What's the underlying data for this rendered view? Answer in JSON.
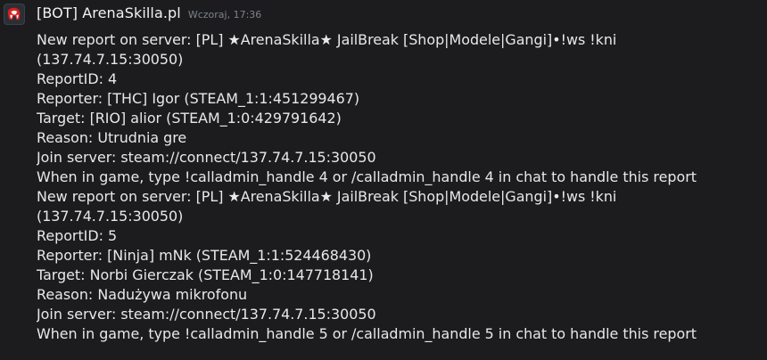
{
  "header": {
    "username": "[BOT] ArenaSkilla.pl",
    "timestamp": "Wczoraj, 17:36"
  },
  "avatar_icon": "arena-helmet-icon",
  "reports": [
    {
      "line1": "New report on server: [PL] ★ArenaSkilla★ JailBreak [Shop|Modele|Gangi]•!ws !kni",
      "line2": "(137.74.7.15:30050)",
      "report_id": "ReportID: 4",
      "reporter": "Reporter: [THC] Igor (STEAM_1:1:451299467)",
      "target": "Target: [RIO] alior (STEAM_1:0:429791642)",
      "reason": "Reason: Utrudnia gre",
      "join": "Join server: steam://connect/137.74.7.15:30050",
      "handle": "When in game, type !calladmin_handle 4 or /calladmin_handle 4 in chat to handle this report"
    },
    {
      "line1": "New report on server: [PL] ★ArenaSkilla★ JailBreak [Shop|Modele|Gangi]•!ws !kni",
      "line2": "(137.74.7.15:30050)",
      "report_id": "ReportID: 5",
      "reporter": "Reporter: [Ninja] mNk (STEAM_1:1:524468430)",
      "target": "Target: Norbi Gierczak (STEAM_1:0:147718141)",
      "reason": "Reason: Nadużywa mikrofonu",
      "join": "Join server: steam://connect/137.74.7.15:30050",
      "handle": "When in game, type !calladmin_handle 5 or /calladmin_handle 5 in chat to handle this report"
    }
  ],
  "colors": {
    "background": "#1c1c1e",
    "text": "#e8e8e8",
    "timestamp": "#7d8389",
    "avatar_red": "#d8201f"
  }
}
